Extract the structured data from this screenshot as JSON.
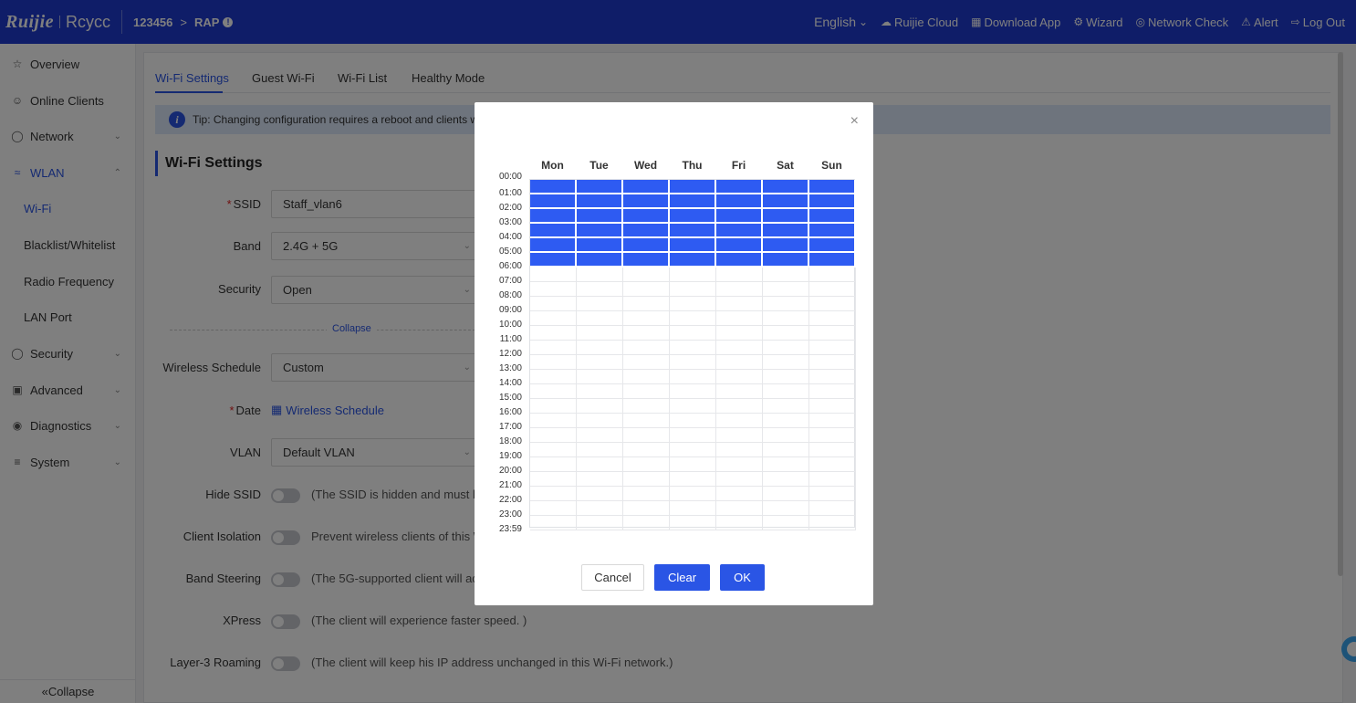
{
  "header": {
    "logo": "Ruijie",
    "logo_secondary": "Rcycc",
    "breadcrumb": {
      "network": "123456",
      "device": "RAP"
    },
    "language": "English",
    "links": {
      "cloud": "Ruijie Cloud",
      "download": "Download App",
      "wizard": "Wizard",
      "network_check": "Network Check",
      "alert": "Alert",
      "logout": "Log Out"
    }
  },
  "sidebar": {
    "items": {
      "overview": "Overview",
      "online_clients": "Online Clients",
      "network": "Network",
      "wlan": "WLAN",
      "wifi": "Wi-Fi",
      "blacklist": "Blacklist/Whitelist",
      "radio": "Radio Frequency",
      "lan_port": "LAN Port",
      "security": "Security",
      "advanced": "Advanced",
      "diagnostics": "Diagnostics",
      "system": "System"
    },
    "collapse": "Collapse"
  },
  "tabs": {
    "wifi_settings": "Wi-Fi Settings",
    "guest_wifi": "Guest Wi-Fi",
    "wifi_list": "Wi-Fi List",
    "healthy_mode": "Healthy Mode"
  },
  "tip": "Tip: Changing configuration requires a reboot and clients will b",
  "section_title": "Wi-Fi Settings",
  "form": {
    "ssid": {
      "label": "SSID",
      "value": "Staff_vlan6"
    },
    "band": {
      "label": "Band",
      "value": "2.4G + 5G"
    },
    "security": {
      "label": "Security",
      "value": "Open"
    },
    "collapse": "Collapse",
    "schedule": {
      "label": "Wireless Schedule",
      "value": "Custom"
    },
    "date": {
      "label": "Date",
      "link": "Wireless Schedule"
    },
    "vlan": {
      "label": "VLAN",
      "value": "Default VLAN"
    },
    "hide_ssid": {
      "label": "Hide SSID",
      "desc": "(The SSID is hidden and must be n"
    },
    "client_isolation": {
      "label": "Client Isolation",
      "desc": "Prevent wireless clients of this Wi-"
    },
    "band_steering": {
      "label": "Band Steering",
      "desc": "(The 5G-supported client will acce"
    },
    "xpress": {
      "label": "XPress",
      "desc": "(The client will experience faster speed. )"
    },
    "roaming": {
      "label": "Layer-3 Roaming",
      "desc": "(The client will keep his IP address unchanged in this Wi-Fi network.)"
    }
  },
  "modal": {
    "days": [
      "Mon",
      "Tue",
      "Wed",
      "Thu",
      "Fri",
      "Sat",
      "Sun"
    ],
    "times": [
      "00:00",
      "01:00",
      "02:00",
      "03:00",
      "04:00",
      "05:00",
      "06:00",
      "07:00",
      "08:00",
      "09:00",
      "10:00",
      "11:00",
      "12:00",
      "13:00",
      "14:00",
      "15:00",
      "16:00",
      "17:00",
      "18:00",
      "19:00",
      "20:00",
      "21:00",
      "22:00",
      "23:00",
      "23:59"
    ],
    "selected_hours_per_day": 6,
    "selected_color": "#2e5bf2",
    "buttons": {
      "cancel": "Cancel",
      "clear": "Clear",
      "ok": "OK"
    }
  },
  "colors": {
    "primary": "#1f3ad1",
    "accent": "#2a55e5"
  }
}
